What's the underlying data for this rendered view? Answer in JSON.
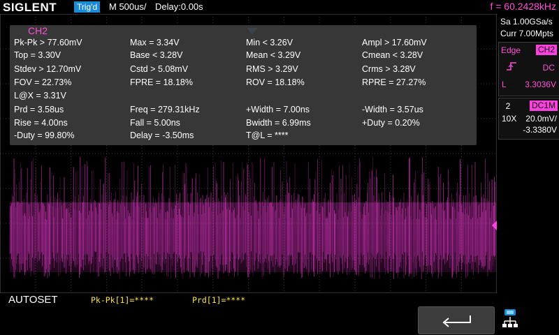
{
  "header": {
    "brand": "SIGLENT",
    "trigger_status": "Trig'd",
    "timebase": "M 500us/",
    "delay": "Delay:0.00s",
    "frequency": "f = 60.2428kHz"
  },
  "measurement_panel": {
    "channel": "CH2",
    "rows": [
      [
        "Pk-Pk > 77.60mV",
        "Max = 3.34V",
        "Min < 3.26V",
        "Ampl > 17.60mV"
      ],
      [
        "Top = 3.30V",
        "Base < 3.28V",
        "Mean < 3.29V",
        "Cmean < 3.28V"
      ],
      [
        "Stdev > 12.70mV",
        "Cstd > 5.08mV",
        "RMS > 3.29V",
        "Crms > 3.28V"
      ],
      [
        "FOV = 22.73%",
        "FPRE = 18.18%",
        "ROV = 18.18%",
        "RPRE = 27.27%"
      ],
      [
        "L@X = 3.31V",
        "",
        "",
        ""
      ],
      [
        "Prd = 3.58us",
        "Freq = 279.31kHz",
        "+Width = 7.00ns",
        "-Width = 3.57us"
      ],
      [
        "Rise = 4.00ns",
        "Fall = 5.00ns",
        "Bwidth = 6.99ms",
        "+Duty = 0.20%"
      ],
      [
        "-Duty = 99.80%",
        "Delay = -3.50ms",
        "T@L = ****",
        ""
      ]
    ]
  },
  "acquisition": {
    "sample_rate": "Sa 1.00GSa/s",
    "memory_depth": "Curr 7.00Mpts"
  },
  "trigger": {
    "type": "Edge",
    "source": "CH2",
    "coupling": "DC",
    "level_label": "L",
    "level_value": "3.3036V"
  },
  "channel": {
    "number": "2",
    "coupling": "DC1M",
    "probe": "10X",
    "volts_per_div": "20.0mV/",
    "offset": "-3.3380V",
    "ground_marker": "2"
  },
  "footer": {
    "autoset": "AUTOSET",
    "stat1": "Pk-Pk[1]=****",
    "stat2": "Prd[1]=****"
  },
  "colors": {
    "channel2": "#ff40e0",
    "trigger_badge": "#1b8bd6",
    "trigger_marker": "#28b4f0",
    "stats_text": "#ffe43a"
  },
  "icons": [
    "rising-edge-icon",
    "back-arrow-icon",
    "network-icon"
  ]
}
